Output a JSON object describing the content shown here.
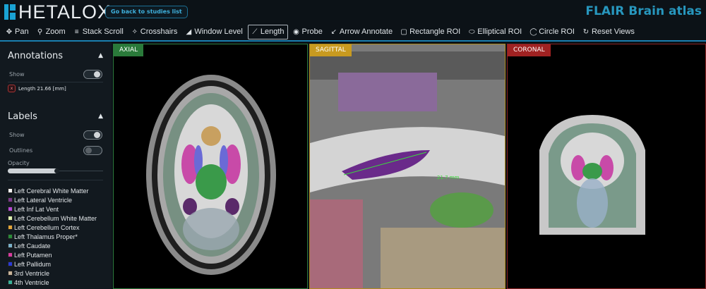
{
  "header": {
    "logo": "HETALOX",
    "back_button": "Go back to studies list",
    "study_title": "FLAIR Brain atlas"
  },
  "toolbar": [
    {
      "label": "Pan",
      "icon": "pan-icon",
      "glyph": "✥"
    },
    {
      "label": "Zoom",
      "icon": "search-icon",
      "glyph": "⚲"
    },
    {
      "label": "Stack Scroll",
      "icon": "bars-icon",
      "glyph": "≡"
    },
    {
      "label": "Crosshairs",
      "icon": "crosshairs-icon",
      "glyph": "✧"
    },
    {
      "label": "Window Level",
      "icon": "adjust-icon",
      "glyph": "◢"
    },
    {
      "label": "Length",
      "icon": "ruler-icon",
      "glyph": "⟋",
      "active": true
    },
    {
      "label": "Probe",
      "icon": "probe-icon",
      "glyph": "◉"
    },
    {
      "label": "Arrow Annotate",
      "icon": "arrow-icon",
      "glyph": "↙"
    },
    {
      "label": "Rectangle ROI",
      "icon": "square-icon",
      "glyph": "▢"
    },
    {
      "label": "Elliptical ROI",
      "icon": "ellipse-icon",
      "glyph": "⬭"
    },
    {
      "label": "Circle ROI",
      "icon": "circle-icon",
      "glyph": "◯"
    },
    {
      "label": "Reset Views",
      "icon": "reset-icon",
      "glyph": "↻"
    }
  ],
  "sidebar": {
    "annotations": {
      "title": "Annotations",
      "show_label": "Show",
      "show": true,
      "items": [
        {
          "remove": "x",
          "label": "Length 21.66 [mm]"
        }
      ]
    },
    "labels": {
      "title": "Labels",
      "show_label": "Show",
      "show": true,
      "outlines_label": "Outlines",
      "outlines": false,
      "opacity_label": "Opacity",
      "opacity": 0.52,
      "legend": [
        {
          "name": "Left Cerebral White Matter",
          "color": "#f5f5f5"
        },
        {
          "name": "Left Lateral Ventricle",
          "color": "#7a3a8c"
        },
        {
          "name": "Left Inf Lat Vent",
          "color": "#b54ad6"
        },
        {
          "name": "Left Cerebellum White Matter",
          "color": "#dcf0b0"
        },
        {
          "name": "Left Cerebellum Cortex",
          "color": "#e2a53a"
        },
        {
          "name": "Left Thalamus Proper*",
          "color": "#2a8a3a"
        },
        {
          "name": "Left Caudate",
          "color": "#79b0c8"
        },
        {
          "name": "Left Putamen",
          "color": "#d63ca0"
        },
        {
          "name": "Left Pallidum",
          "color": "#2a3ad6"
        },
        {
          "name": "3rd Ventricle",
          "color": "#c8b49a"
        },
        {
          "name": "4th Ventricle",
          "color": "#3ab09a"
        }
      ]
    }
  },
  "viewports": {
    "axial": {
      "label": "AXIAL",
      "color": "#2a7a3a"
    },
    "sagittal": {
      "label": "SAGITTAL",
      "color": "#c89a20",
      "measurement": "21.7 mm"
    },
    "coronal": {
      "label": "CORONAL",
      "color": "#a02222"
    }
  }
}
